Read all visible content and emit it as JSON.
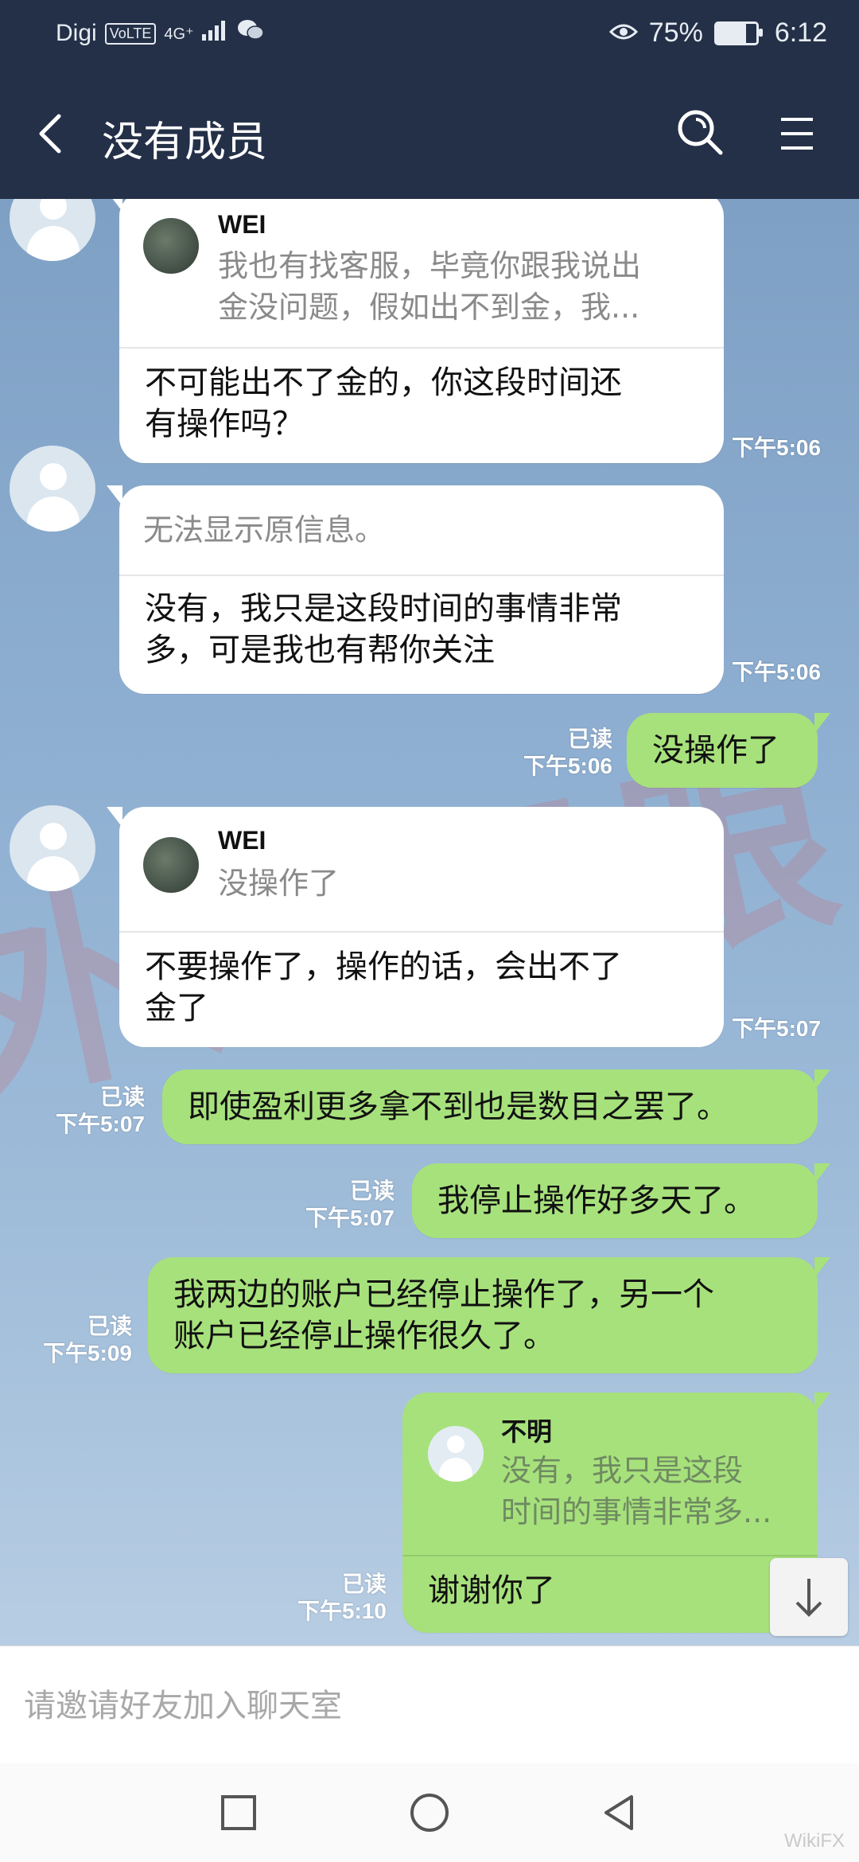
{
  "status_bar": {
    "carrier": "Digi",
    "volte": "VoLTE",
    "network": "4G⁺",
    "battery_percent_label": "75%",
    "battery_level": 0.75,
    "time": "6:12"
  },
  "header": {
    "title": "没有成员"
  },
  "messages": [
    {
      "side": "left",
      "quote_name": "WEI",
      "quote_lines": [
        "我也有找客服，毕竟你跟我说出",
        "金没问题，假如出不到金，我..."
      ],
      "lines": [
        "不可能出不了金的，你这段时间还",
        "有操作吗？"
      ],
      "time": "下午5:06"
    },
    {
      "side": "left",
      "quote_lines": [
        "无法显示原信息。"
      ],
      "lines": [
        "没有，我只是这段时间的事情非常",
        "多，可是我也有帮你关注"
      ],
      "time": "下午5:06"
    },
    {
      "side": "right",
      "read": "已读",
      "time": "下午5:06",
      "lines": [
        "没操作了"
      ]
    },
    {
      "side": "left",
      "quote_name": "WEI",
      "quote_lines": [
        "没操作了"
      ],
      "lines": [
        "不要操作了，操作的话，会出不了",
        "金了"
      ],
      "time": "下午5:07"
    },
    {
      "side": "right",
      "read": "已读",
      "time": "下午5:07",
      "lines": [
        "即使盈利更多拿不到也是数目之罢了。"
      ]
    },
    {
      "side": "right",
      "read": "已读",
      "time": "下午5:07",
      "lines": [
        "我停止操作好多天了。"
      ]
    },
    {
      "side": "right",
      "read": "已读",
      "time": "下午5:09",
      "lines": [
        "我两边的账户已经停止操作了，另一个",
        "账户已经停止操作很久了。"
      ]
    },
    {
      "side": "right",
      "read": "已读",
      "time": "下午5:10",
      "quote_name": "不明",
      "quote_lines": [
        "没有，我只是这段",
        "时间的事情非常多..."
      ],
      "lines": [
        "谢谢你了"
      ]
    }
  ],
  "input": {
    "placeholder": "请邀请好友加入聊天室"
  },
  "watermark_text": "外汇天眼",
  "corner_logo": "WikiFX",
  "icons": {
    "back": "back-arrow-icon",
    "search": "search-icon",
    "menu": "menu-icon",
    "scroll": "arrow-down-icon",
    "nav_recent": "square-icon",
    "nav_home": "circle-icon",
    "nav_back": "triangle-back-icon"
  }
}
